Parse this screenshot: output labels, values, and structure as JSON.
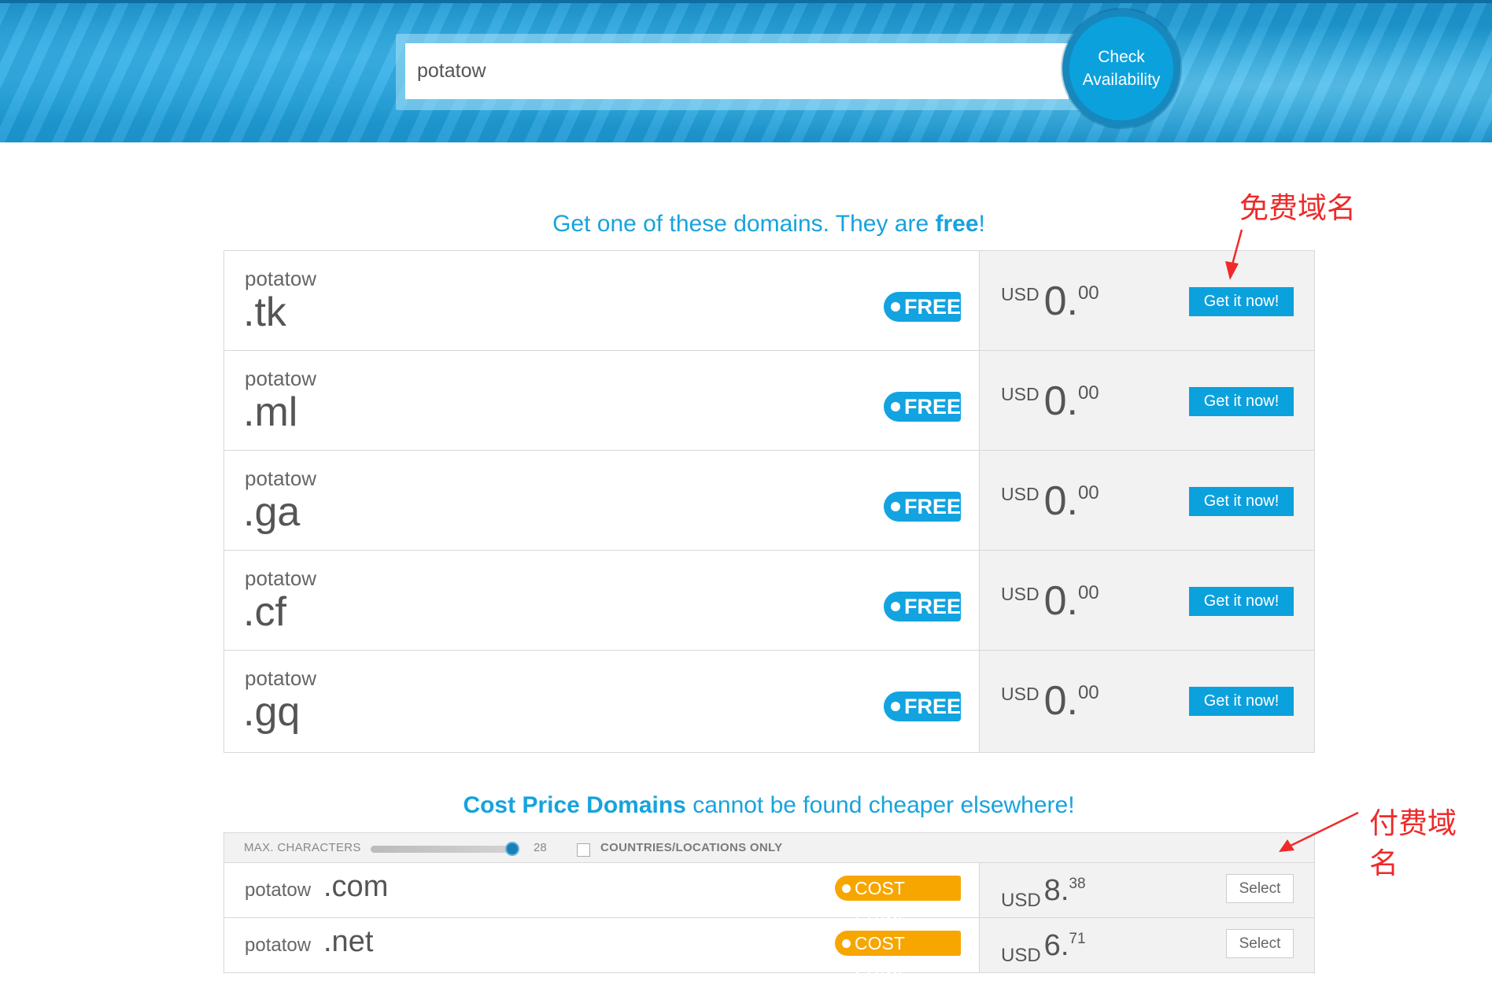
{
  "search": {
    "value": "potatow",
    "button_line1": "Check",
    "button_line2": "Availability"
  },
  "free_section": {
    "title_prefix": "Get one of these domains. They are ",
    "title_bold": "free",
    "title_suffix": "!",
    "domains": [
      {
        "name": "potatow",
        "ext": ".tk",
        "badge": "FREE",
        "currency": "USD",
        "price_int": "0",
        "price_sep": ".",
        "price_cents": "00",
        "button": "Get it now!"
      },
      {
        "name": "potatow",
        "ext": ".ml",
        "badge": "FREE",
        "currency": "USD",
        "price_int": "0",
        "price_sep": ".",
        "price_cents": "00",
        "button": "Get it now!"
      },
      {
        "name": "potatow",
        "ext": ".ga",
        "badge": "FREE",
        "currency": "USD",
        "price_int": "0",
        "price_sep": ".",
        "price_cents": "00",
        "button": "Get it now!"
      },
      {
        "name": "potatow",
        "ext": ".cf",
        "badge": "FREE",
        "currency": "USD",
        "price_int": "0",
        "price_sep": ".",
        "price_cents": "00",
        "button": "Get it now!"
      },
      {
        "name": "potatow",
        "ext": ".gq",
        "badge": "FREE",
        "currency": "USD",
        "price_int": "0",
        "price_sep": ".",
        "price_cents": "00",
        "button": "Get it now!"
      }
    ]
  },
  "cost_section": {
    "title_bold": "Cost Price Domains",
    "title_rest": " cannot be found cheaper elsewhere!",
    "filter": {
      "max_label": "MAX. CHARACTERS",
      "max_value": "28",
      "slider_fraction": 0.95,
      "countries_label": "COUNTRIES/LOCATIONS ONLY",
      "countries_checked": false
    },
    "domains": [
      {
        "name": "potatow",
        "ext": ".com",
        "badge": "COST PRICE",
        "currency": "USD",
        "price_int": "8",
        "price_sep": ".",
        "price_cents": "38",
        "button": "Select"
      },
      {
        "name": "potatow",
        "ext": ".net",
        "badge": "COST PRICE",
        "currency": "USD",
        "price_int": "6",
        "price_sep": ".",
        "price_cents": "71",
        "button": "Select"
      }
    ]
  },
  "annotations": {
    "free_label": "免费域名",
    "paid_label_line1": "付费域",
    "paid_label_line2": "名"
  },
  "colors": {
    "brand_blue": "#0ba1dd",
    "title_blue": "#17a3dd",
    "cost_orange": "#f7a600",
    "annotation_red": "#ee2a2a"
  }
}
